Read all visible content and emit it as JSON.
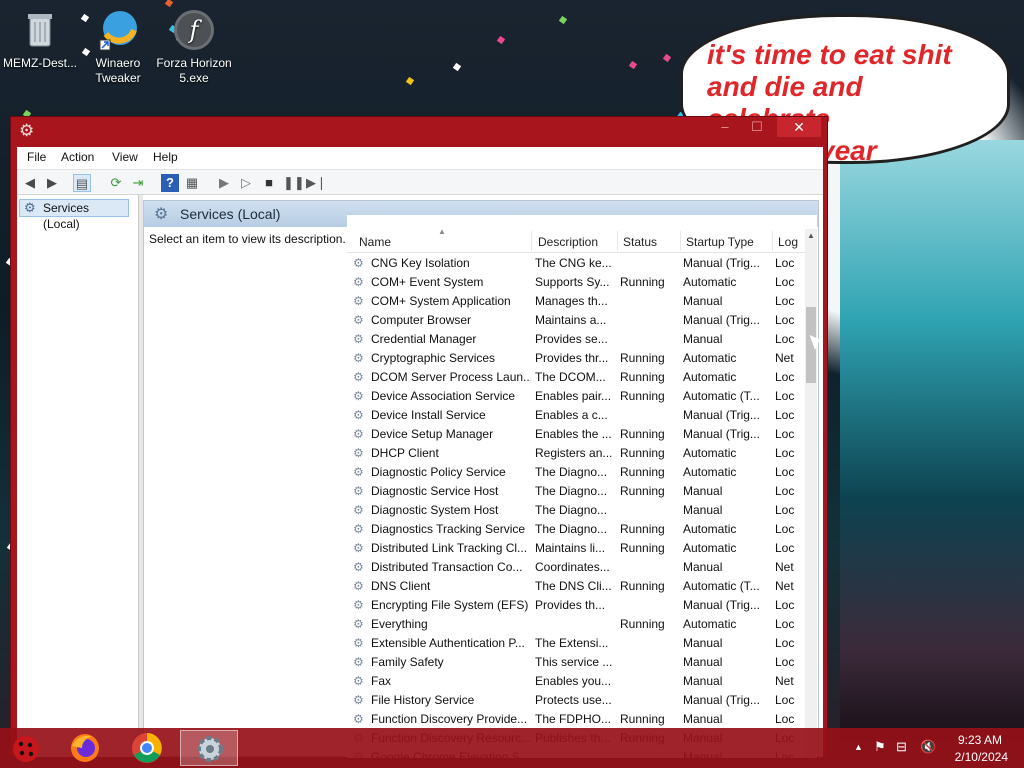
{
  "desktop": {
    "icons": [
      {
        "label": "MEMZ-Dest..."
      },
      {
        "label": "Winaero Tweaker"
      },
      {
        "label": "Forza Horizon 5.exe"
      }
    ],
    "bubble_text": "it's time to eat shit\nand die and celebrate\nthe new year"
  },
  "window": {
    "title": "",
    "close_glyph": "✕",
    "menu": [
      "File",
      "Action",
      "View",
      "Help"
    ],
    "tree_item": "Services (Local)",
    "pane_title": "Services (Local)",
    "description_prompt": "Select an item to view its description.",
    "columns": [
      "Name",
      "Description",
      "Status",
      "Startup Type",
      "Log"
    ],
    "rows": [
      [
        "CNG Key Isolation",
        "The CNG ke...",
        "",
        "Manual (Trig...",
        "Loc"
      ],
      [
        "COM+ Event System",
        "Supports Sy...",
        "Running",
        "Automatic",
        "Loc"
      ],
      [
        "COM+ System Application",
        "Manages th...",
        "",
        "Manual",
        "Loc"
      ],
      [
        "Computer Browser",
        "Maintains a...",
        "",
        "Manual (Trig...",
        "Loc"
      ],
      [
        "Credential Manager",
        "Provides se...",
        "",
        "Manual",
        "Loc"
      ],
      [
        "Cryptographic Services",
        "Provides thr...",
        "Running",
        "Automatic",
        "Net"
      ],
      [
        "DCOM Server Process Laun...",
        "The DCOM...",
        "Running",
        "Automatic",
        "Loc"
      ],
      [
        "Device Association Service",
        "Enables pair...",
        "Running",
        "Automatic (T...",
        "Loc"
      ],
      [
        "Device Install Service",
        "Enables a c...",
        "",
        "Manual (Trig...",
        "Loc"
      ],
      [
        "Device Setup Manager",
        "Enables the ...",
        "Running",
        "Manual (Trig...",
        "Loc"
      ],
      [
        "DHCP Client",
        "Registers an...",
        "Running",
        "Automatic",
        "Loc"
      ],
      [
        "Diagnostic Policy Service",
        "The Diagno...",
        "Running",
        "Automatic",
        "Loc"
      ],
      [
        "Diagnostic Service Host",
        "The Diagno...",
        "Running",
        "Manual",
        "Loc"
      ],
      [
        "Diagnostic System Host",
        "The Diagno...",
        "",
        "Manual",
        "Loc"
      ],
      [
        "Diagnostics Tracking Service",
        "The Diagno...",
        "Running",
        "Automatic",
        "Loc"
      ],
      [
        "Distributed Link Tracking Cl...",
        "Maintains li...",
        "Running",
        "Automatic",
        "Loc"
      ],
      [
        "Distributed Transaction Co...",
        "Coordinates...",
        "",
        "Manual",
        "Net"
      ],
      [
        "DNS Client",
        "The DNS Cli...",
        "Running",
        "Automatic (T...",
        "Net"
      ],
      [
        "Encrypting File System (EFS)",
        "Provides th...",
        "",
        "Manual (Trig...",
        "Loc"
      ],
      [
        "Everything",
        "",
        "Running",
        "Automatic",
        "Loc"
      ],
      [
        "Extensible Authentication P...",
        "The Extensi...",
        "",
        "Manual",
        "Loc"
      ],
      [
        "Family Safety",
        "This service ...",
        "",
        "Manual",
        "Loc"
      ],
      [
        "Fax",
        "Enables you...",
        "",
        "Manual",
        "Net"
      ],
      [
        "File History Service",
        "Protects use...",
        "",
        "Manual (Trig...",
        "Loc"
      ],
      [
        "Function Discovery Provide...",
        "The FDPHO...",
        "Running",
        "Manual",
        "Loc"
      ],
      [
        "Function Discovery Resourc...",
        "Publishes th...",
        "Running",
        "Manual",
        "Loc"
      ],
      [
        "Google Chrome Elevation S...",
        "",
        "",
        "Manual",
        "Loc"
      ]
    ]
  },
  "taskbar": {
    "time": "9:23 AM",
    "date": "2/10/2024"
  }
}
